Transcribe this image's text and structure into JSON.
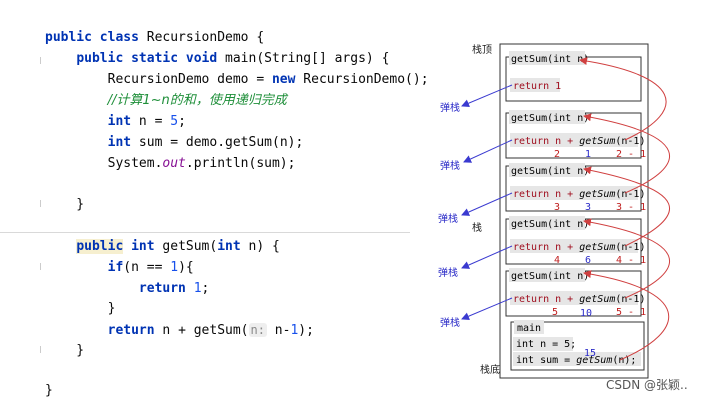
{
  "code": {
    "lines": [
      {
        "pre": "",
        "kw1": "public class",
        "rest": " RecursionDemo {"
      },
      {
        "pre": "    ",
        "kw1": "public static void",
        "rest": " main(String[] args) {"
      },
      {
        "t1": "        RecursionDemo demo = ",
        "kw": "new",
        "t2": " RecursionDemo();"
      },
      {
        "pre": "        ",
        "comment": "//计算1~n的和，使用递归完成"
      },
      {
        "pre": "        ",
        "kw": "int",
        "t1": " n = ",
        "num": "5",
        "t2": ";"
      },
      {
        "pre": "        ",
        "kw": "int",
        "rest": " sum = demo.getSum(n);"
      },
      {
        "t1": "        System.",
        "st": "out",
        "t2": ".println(sum);"
      },
      {
        "text": "    }"
      },
      {
        "pre": "    ",
        "kw1": "public",
        "kw2": "int",
        "t1": " getSum(",
        "kw3": "int",
        "t2": " n) {"
      },
      {
        "pre": "        ",
        "kw": "if",
        "t1": "(n == ",
        "num": "1",
        "t2": "){"
      },
      {
        "pre": "            ",
        "kw": "return",
        "num": "1",
        "t2": ";"
      },
      {
        "text": "        }"
      },
      {
        "pre": "        ",
        "kw": "return",
        "t1": " n + getSum(",
        "hint": "n:",
        "t2": " n-",
        "num": "1",
        "t3": ");"
      },
      {
        "text": "    }"
      },
      {
        "text": "}"
      }
    ]
  },
  "diagram": {
    "top_label": "栈顶",
    "stack_label": "栈",
    "bottom_label": "栈底",
    "pop_label": "弹栈",
    "frames": [
      {
        "header": "getSum(int n)",
        "body": "return 1",
        "nums": []
      },
      {
        "header": "getSum(int n)",
        "body_a": "return n + ",
        "body_fn": "getSum",
        "body_b": "(n-1)",
        "nums": [
          "2",
          "1",
          "2 - 1"
        ]
      },
      {
        "header": "getSum(int n)",
        "body_a": "return n + ",
        "body_fn": "getSum",
        "body_b": "(n-1)",
        "nums": [
          "3",
          "3",
          "3 - 1"
        ]
      },
      {
        "header": "getSum(int n)",
        "body_a": "return n + ",
        "body_fn": "getSum",
        "body_b": "(n-1)",
        "nums": [
          "4",
          "6",
          "4 - 1"
        ]
      },
      {
        "header": "getSum(int n)",
        "body_a": "return n + ",
        "body_fn": "getSum",
        "body_b": "(n-1)",
        "nums": [
          "5",
          "10",
          "5 - 1"
        ]
      }
    ],
    "main": {
      "header": "main",
      "line1": "int n = 5;",
      "line2_a": "int sum = ",
      "line2_fn": "getSum",
      "line2_b": "(n);",
      "result": "15"
    },
    "colors": {
      "arrow_pop": "#3a3ad0",
      "arrow_call": "#d04040",
      "header_bg": "#e6e6e6"
    }
  },
  "watermark": "CSDN @张颖.."
}
